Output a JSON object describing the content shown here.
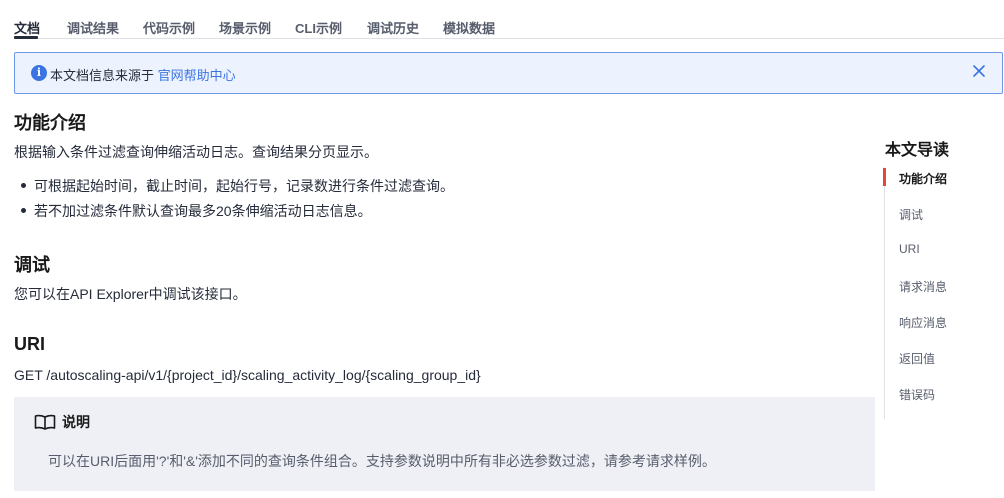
{
  "tabs": [
    {
      "label": "文档"
    },
    {
      "label": "调试结果"
    },
    {
      "label": "代码示例"
    },
    {
      "label": "场景示例"
    },
    {
      "label": "CLI示例"
    },
    {
      "label": "调试历史"
    },
    {
      "label": "模拟数据"
    }
  ],
  "banner": {
    "icon": "info-icon",
    "text": "本文档信息来源于",
    "link": "官网帮助中心",
    "close_icon": "close-icon"
  },
  "sections": {
    "intro": {
      "title": "功能介绍",
      "description": "根据输入条件过滤查询伸缩活动日志。查询结果分页显示。",
      "bullets": [
        "可根据起始时间，截止时间，起始行号，记录数进行条件过滤查询。",
        "若不加过滤条件默认查询最多20条伸缩活动日志信息。"
      ]
    },
    "debug": {
      "title": "调试",
      "description": "您可以在API Explorer中调试该接口。"
    },
    "uri": {
      "title": "URI",
      "value": "GET /autoscaling-api/v1/{project_id}/scaling_activity_log/{scaling_group_id}"
    }
  },
  "note": {
    "icon": "book-icon",
    "title": "说明",
    "text": "可以在URI后面用'?'和'&'添加不同的查询条件组合。支持参数说明中所有非必选参数过滤，请参考请求样例。"
  },
  "toc": {
    "title": "本文导读",
    "items": [
      {
        "label": "功能介绍"
      },
      {
        "label": "调试"
      },
      {
        "label": "URI"
      },
      {
        "label": "请求消息"
      },
      {
        "label": "响应消息"
      },
      {
        "label": "返回值"
      },
      {
        "label": "错误码"
      }
    ]
  },
  "colors": {
    "accent": "#3b74e0",
    "toc_active": "#e8453c",
    "banner_bg": "#edf3fe",
    "note_bg": "#eef0f5"
  }
}
